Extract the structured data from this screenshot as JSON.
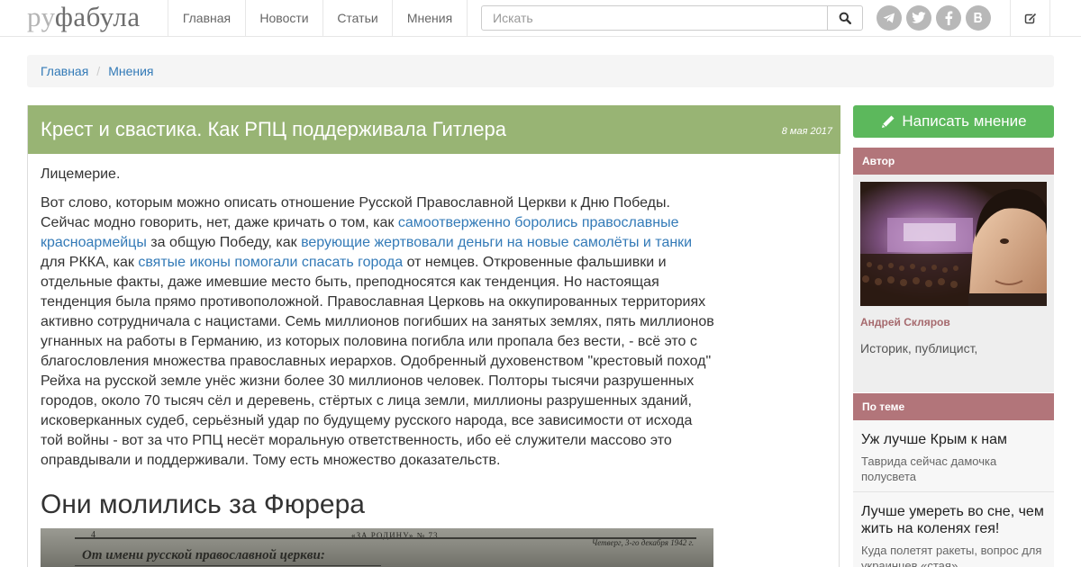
{
  "site": {
    "logo_ru": "ру",
    "logo_fabula": "фабула"
  },
  "nav": {
    "items": [
      "Главная",
      "Новости",
      "Статьи",
      "Мнения"
    ]
  },
  "search": {
    "placeholder": "Искать"
  },
  "social_icons": [
    "telegram-icon",
    "twitter-icon",
    "facebook-icon",
    "vk-icon"
  ],
  "breadcrumb": {
    "items": [
      "Главная",
      "Мнения"
    ]
  },
  "article": {
    "title": "Крест и свастика. Как РПЦ поддерживала Гитлера",
    "date": "8 мая 2017",
    "p1": "Лицемерие.",
    "p2_a": "Вот слово, которым можно описать отношение Русской Православной Церкви к Дню Победы. Сейчас модно говорить, нет, даже кричать о том, как ",
    "p2_link1": "самоотверженно боролись православные красноармейцы",
    "p2_b": " за общую Победу, как ",
    "p2_link2": "верующие жертвовали деньги на новые самолёты и танки",
    "p2_c": " для РККА, как ",
    "p2_link3": "святые иконы помогали спасать города",
    "p2_d": " от немцев. Откровенные фальшивки и отдельные факты, даже имевшие место быть, преподносятся как тенденция. Но настоящая тенденция была прямо противоположной. Православная Церковь на оккупированных территориях активно сотрудничала с нацистами. Семь миллионов погибших на занятых землях, пять миллионов угнанных на работы в Германию, из которых половина погибла или пропала без вести, - всё это с благословления множества православных иерархов. Одобренный духовенством \"крестовый поход\" Рейха на русской земле унёс жизни более 30 миллионов человек. Полторы тысячи разрушенных городов, около 70 тысяч сёл и деревень, стёртых с лица земли, миллионы разрушенных зданий, исковерканных судеб, серьёзный удар по будущему русского народа, все зависимости от исхода той войны - вот за что РПЦ несёт моральную ответственность, ибо её служители массово это оправдывали и поддерживали. Тому есть множество доказательств.",
    "h2": "Они молились за Фюрера",
    "newspaper": {
      "page_num": "4",
      "masthead": "«ЗА РОДИНУ» № 73",
      "date": "Четверг, 3-го декабря 1942 г.",
      "headline": "От имени русской православной церкви:"
    }
  },
  "sidebar": {
    "write_button": "Написать мнение",
    "author_heading": "Автор",
    "author_name": "Андрей Скляров",
    "author_bio": "Историк, публицист,",
    "topic_heading": "По теме",
    "topics": [
      {
        "title": "Уж лучше Крым к нам",
        "subtitle": "Таврида сейчас дамочка полусвета"
      },
      {
        "title": "Лучше умереть во сне, чем жить на коленях гея!",
        "subtitle": "Куда полетят ракеты, вопрос для украинцев «стая»"
      }
    ]
  }
}
